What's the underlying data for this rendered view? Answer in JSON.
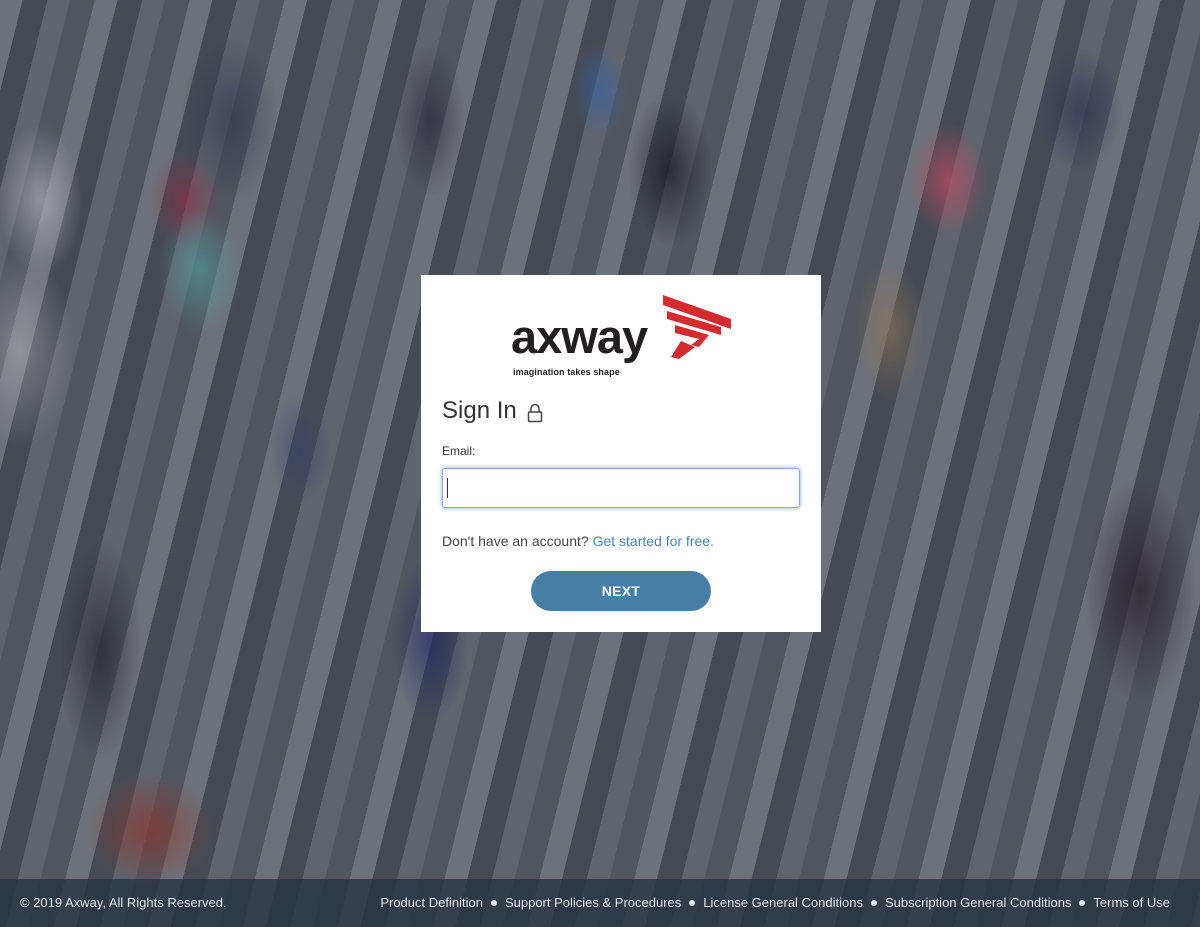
{
  "brand": {
    "name": "axway",
    "tagline": "imagination takes shape",
    "accent_color": "#d52b2f"
  },
  "signin": {
    "title": "Sign In",
    "email_label": "Email:",
    "email_value": "",
    "no_account_text": "Don't have an account?",
    "get_started_link": "Get started for free.",
    "next_button": "NEXT",
    "button_color": "#467ea6"
  },
  "footer": {
    "copyright": "© 2019 Axway, All Rights Reserved.",
    "links": [
      "Product Definition",
      "Support Policies & Procedures",
      "License General Conditions",
      "Subscription General Conditions",
      "Terms of Use"
    ]
  },
  "icons": {
    "lock": "lock-icon",
    "logo_mark": "axway-logo-icon"
  }
}
